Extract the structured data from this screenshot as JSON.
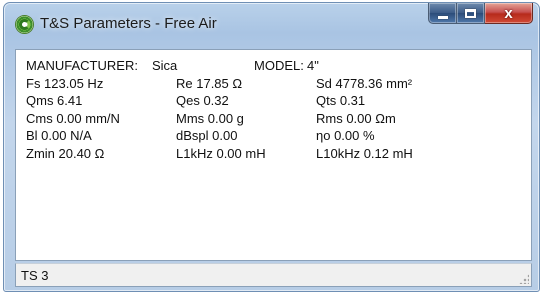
{
  "window": {
    "title": "T&S Parameters - Free Air",
    "icon": "app-logo-icon",
    "controls": {
      "minimize": "minimize-icon",
      "maximize": "maximize-icon",
      "close": "close-icon",
      "close_glyph": "x"
    },
    "colors": {
      "titlebar": "#a9c4e3",
      "close_button": "#c75050",
      "client": "#ffffff"
    }
  },
  "header": {
    "manufacturer_label": "MANUFACTURER:",
    "manufacturer_value": "Sica",
    "model_label": "MODEL:",
    "model_value": "4\""
  },
  "params": [
    [
      "Fs 123.05 Hz",
      "Re 17.85 Ω",
      "Sd 4778.36 mm²"
    ],
    [
      "Qms 6.41",
      "Qes 0.32",
      "Qts 0.31"
    ],
    [
      "Cms 0.00 mm/N",
      "Mms 0.00 g",
      "Rms 0.00 Ωm"
    ],
    [
      "Bl  0.00 N/A",
      "dBspl 0.00",
      "ηo  0.00 %"
    ],
    [
      "Zmin  20.40 Ω",
      "L1kHz  0.00 mH",
      "L10kHz 0.12 mH"
    ]
  ],
  "status": {
    "text": "TS 3"
  }
}
